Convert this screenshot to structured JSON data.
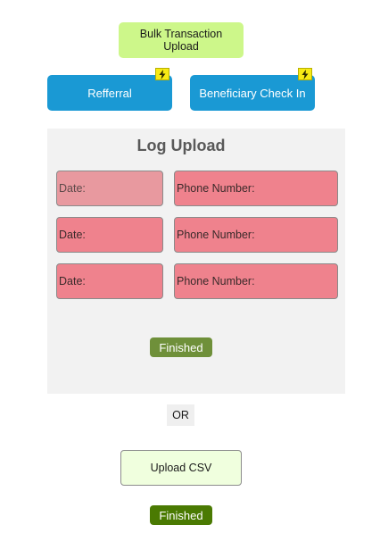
{
  "header": {
    "bulk_upload_label": "Bulk Transaction Upload"
  },
  "actions": {
    "referral_label": "Refferral",
    "beneficiary_label": "Beneficiary Check In"
  },
  "log_upload": {
    "title": "Log Upload",
    "rows": [
      {
        "date_label": "Date:",
        "phone_label": "Phone Number:"
      },
      {
        "date_label": "Date:",
        "phone_label": "Phone Number:"
      },
      {
        "date_label": "Date:",
        "phone_label": "Phone Number:"
      }
    ],
    "finished_label": "Finished"
  },
  "separator": {
    "or_label": "OR"
  },
  "csv": {
    "upload_label": "Upload CSV",
    "finished_label": "Finished"
  },
  "colors": {
    "bulk_button": "#cdf78a",
    "blue_button": "#1a99d4",
    "field_bg": "#ef828d",
    "finished_log": "#6f903a",
    "finished_csv": "#4a7a02",
    "csv_button": "#f0ffde",
    "bolt_badge": "#f7ea14"
  },
  "icons": {
    "badge": "lightning-bolt-icon"
  }
}
